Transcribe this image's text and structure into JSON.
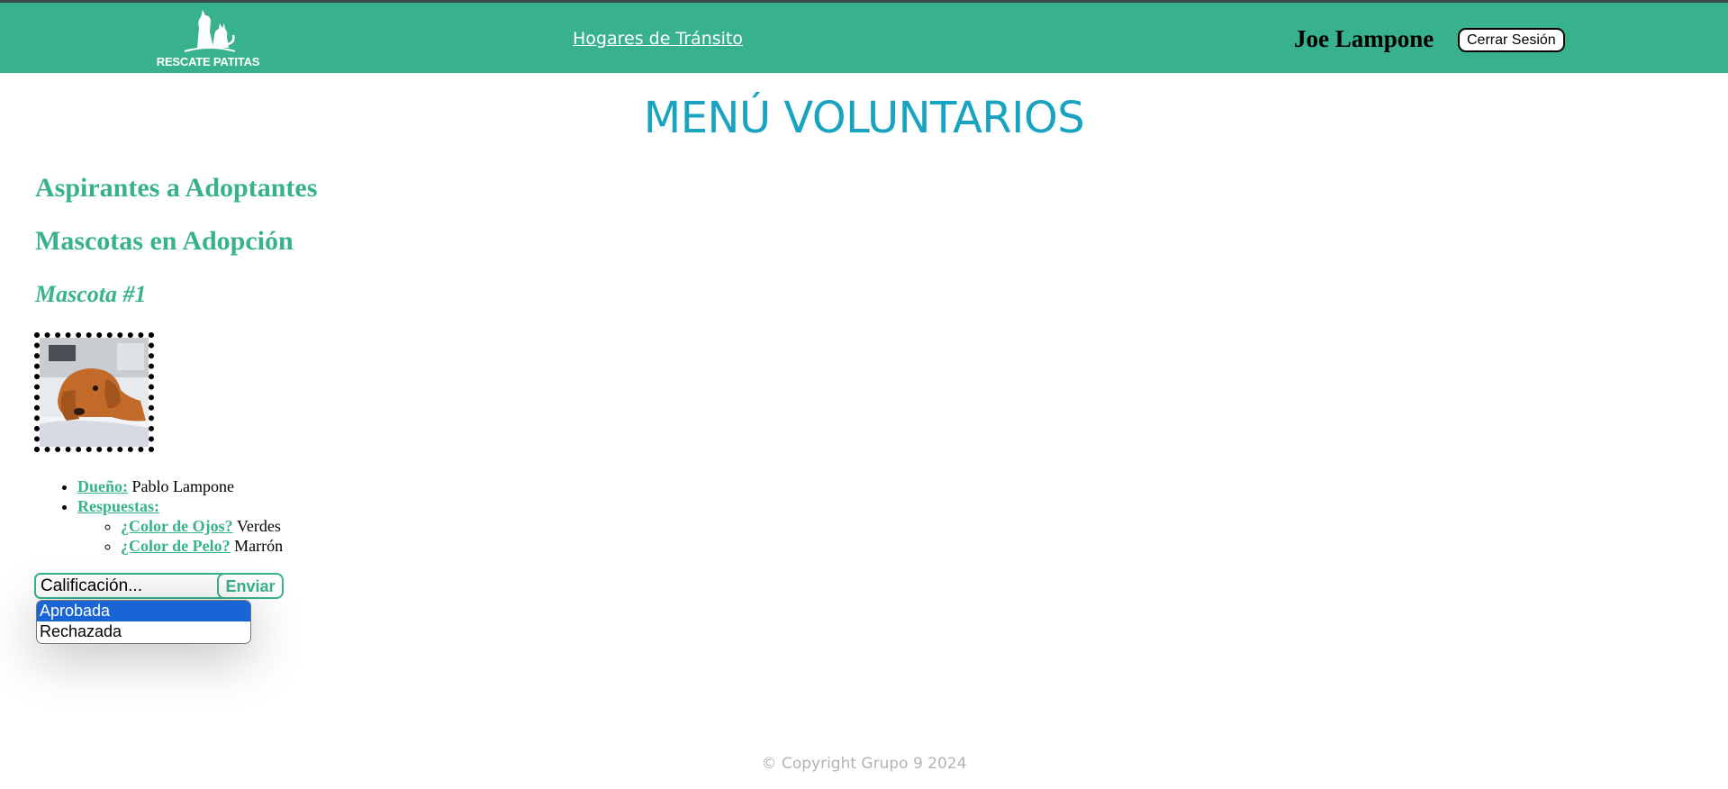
{
  "header": {
    "logo_text": "RESCATE PATITAS",
    "nav_link": "Hogares de Tránsito",
    "user_name": "Joe Lampone",
    "logout_label": "Cerrar Sesión"
  },
  "main": {
    "title": "MENÚ VOLUNTARIOS",
    "sections": [
      "Aspirantes a Adoptantes",
      "Mascotas en Adopción"
    ],
    "pet": {
      "heading": "Mascota #1",
      "owner_label": "Dueño:",
      "owner_value": "Pablo Lampone",
      "answers_label": "Respuestas:",
      "answers": [
        {
          "question": "¿Color de Ojos?",
          "answer": "Verdes"
        },
        {
          "question": "¿Color de Pelo?",
          "answer": "Marrón"
        }
      ]
    },
    "rating": {
      "placeholder": "Calificación...",
      "send_label": "Enviar",
      "options": [
        "Aprobada",
        "Rechazada"
      ],
      "highlighted_option": "Aprobada"
    }
  },
  "footer": {
    "copyright": "© Copyright Grupo 9 2024"
  },
  "colors": {
    "brand_green": "#38b28d",
    "title_blue": "#18a3c1",
    "highlight_blue": "#1a65d6"
  }
}
